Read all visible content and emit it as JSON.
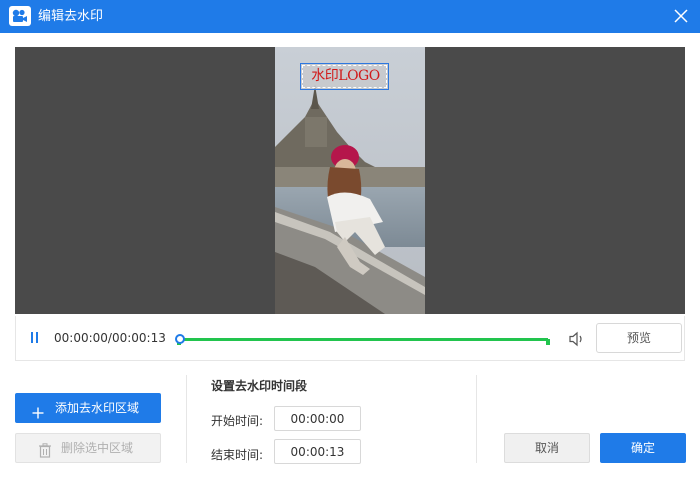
{
  "window": {
    "title": "编辑去水印",
    "app_icon": "video-camera-icon",
    "close_icon": "close-icon"
  },
  "video": {
    "watermark_text": "水印LOGO"
  },
  "player": {
    "time_display": "00:00:00/00:00:13",
    "progress": 0,
    "preview_label": "预览"
  },
  "actions": {
    "add_region_label": "添加去水印区域",
    "delete_region_label": "删除选中区域"
  },
  "timing": {
    "section_title": "设置去水印时间段",
    "start_label": "开始时间:",
    "start_value": "00:00:00",
    "end_label": "结束时间:",
    "end_value": "00:00:13"
  },
  "footer": {
    "cancel_label": "取消",
    "ok_label": "确定"
  },
  "colors": {
    "accent": "#1f7be8",
    "progress": "#22c44e",
    "watermark_text": "#d11a1a"
  }
}
